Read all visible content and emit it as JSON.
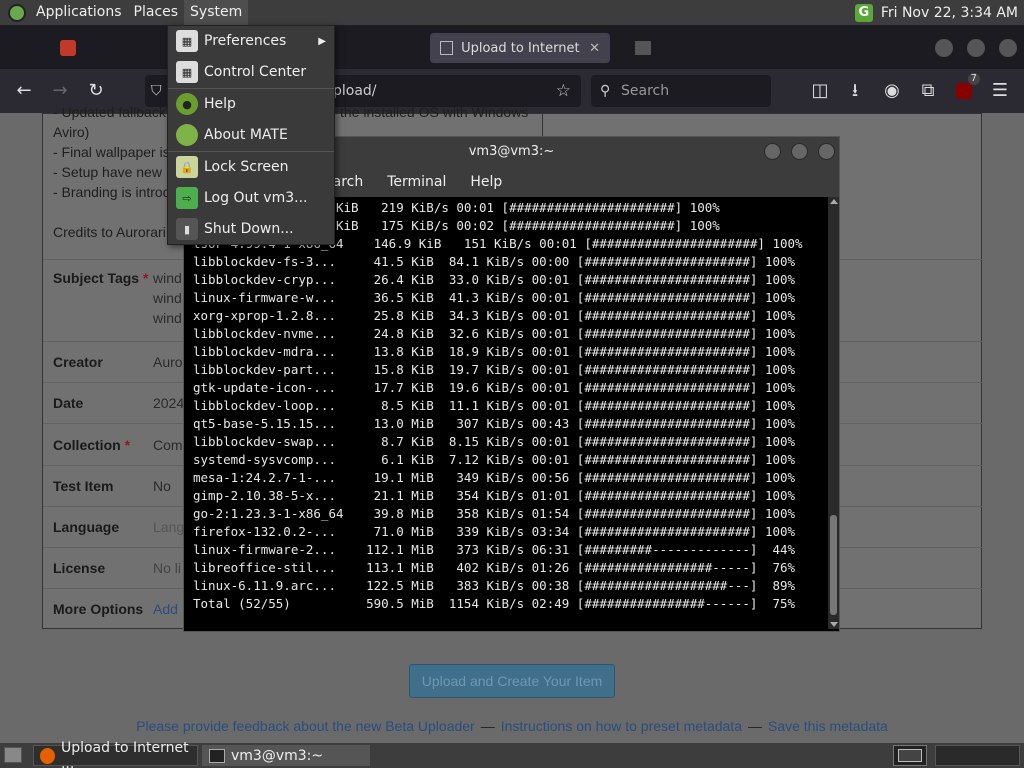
{
  "panel": {
    "menus": [
      "Applications",
      "Places",
      "System"
    ],
    "clock": "Fri Nov 22,  3:34 AM"
  },
  "browser": {
    "tab_title": "Upload to Internet Ar",
    "url_partial": "pload/",
    "search_placeholder": "Search",
    "extension_badge": "7"
  },
  "page": {
    "description_lines": [
      "- Updated fallback",
      "Aviro)",
      "- Final wallpaper is",
      "- Setup have new",
      "- Branding is introd",
      "",
      "Credits to Aurorari"
    ],
    "desc_right": "the installed OS with Windows",
    "rows": [
      {
        "label": "Subject Tags",
        "required": true,
        "value": "wind"
      },
      {
        "label": "Creator",
        "required": false,
        "value": "Auro"
      },
      {
        "label": "Date",
        "required": false,
        "value": "2024"
      },
      {
        "label": "Collection",
        "required": true,
        "value": "Com"
      },
      {
        "label": "Test Item",
        "required": false,
        "value": "No"
      },
      {
        "label": "Language",
        "required": false,
        "value": "Lang"
      },
      {
        "label": "License",
        "required": false,
        "value": "No li"
      },
      {
        "label": "More Options",
        "required": false,
        "value": "Add"
      }
    ],
    "subject_extra": [
      "wind",
      "wind"
    ],
    "upload_button": "Upload and Create Your Item",
    "feedback_links": [
      "Please provide feedback about the new Beta Uploader",
      "Instructions on how to preset metadata",
      "Save this metadata"
    ],
    "feedback_sep": "—"
  },
  "terminal": {
    "title": "vm3@vm3:~",
    "menu": [
      "earch",
      "Terminal",
      "Help"
    ],
    "lines": [
      "             251.5 KiB   219 KiB/s 00:01 [######################] 100%",
      "             263.2 KiB   175 KiB/s 00:02 [######################] 100%",
      "tsoF-4.99.4-1-x86_64    146.9 KiB   151 KiB/s 00:01 [######################] 100%",
      "libblockdev-fs-3...     41.5 KiB  84.1 KiB/s 00:00 [######################] 100%",
      "libblockdev-cryp...     26.4 KiB  33.0 KiB/s 00:01 [######################] 100%",
      "linux-firmware-w...     36.5 KiB  41.3 KiB/s 00:01 [######################] 100%",
      "xorg-xprop-1.2.8...     25.8 KiB  34.3 KiB/s 00:01 [######################] 100%",
      "libblockdev-nvme...     24.8 KiB  32.6 KiB/s 00:01 [######################] 100%",
      "libblockdev-mdra...     13.8 KiB  18.9 KiB/s 00:01 [######################] 100%",
      "libblockdev-part...     15.8 KiB  19.7 KiB/s 00:01 [######################] 100%",
      "gtk-update-icon-...     17.7 KiB  19.6 KiB/s 00:01 [######################] 100%",
      "libblockdev-loop...      8.5 KiB  11.1 KiB/s 00:01 [######################] 100%",
      "qt5-base-5.15.15...     13.0 MiB   307 KiB/s 00:43 [######################] 100%",
      "libblockdev-swap...      8.7 KiB  8.15 KiB/s 00:01 [######################] 100%",
      "systemd-sysvcomp...      6.1 KiB  7.12 KiB/s 00:01 [######################] 100%",
      "mesa-1:24.2.7-1-...     19.1 MiB   349 KiB/s 00:56 [######################] 100%",
      "gimp-2.10.38-5-x...     21.1 MiB   354 KiB/s 01:01 [######################] 100%",
      "go-2:1.23.3-1-x86_64    39.8 MiB   358 KiB/s 01:54 [######################] 100%",
      "firefox-132.0.2-...     71.0 MiB   339 KiB/s 03:34 [######################] 100%",
      "linux-firmware-2...    112.1 MiB   373 KiB/s 06:31 [#########-------------]  44%",
      "libreoffice-stil...    113.1 MiB   402 KiB/s 01:26 [#################-----]  76%",
      "linux-6.11.9.arc...    122.5 MiB   383 KiB/s 00:38 [###################---]  89%",
      "Total (52/55)          590.5 MiB  1154 KiB/s 02:49 [################------]  75%"
    ]
  },
  "system_menu": {
    "items": [
      {
        "label": "Preferences",
        "icon": "preferences-icon",
        "submenu": true
      },
      {
        "label": "Control Center",
        "icon": "control-center-icon",
        "submenu": false
      },
      {
        "label": "Help",
        "icon": "help-icon",
        "submenu": false
      },
      {
        "label": "About MATE",
        "icon": "mate-logo-icon",
        "submenu": false
      },
      {
        "label": "Lock Screen",
        "icon": "lock-screen-icon",
        "submenu": false
      },
      {
        "label": "Log Out vm3...",
        "icon": "log-out-icon",
        "submenu": false
      },
      {
        "label": "Shut Down...",
        "icon": "shut-down-icon",
        "submenu": false
      }
    ]
  },
  "taskbar": {
    "items": [
      "Upload to Internet ...",
      "vm3@vm3:~"
    ]
  }
}
